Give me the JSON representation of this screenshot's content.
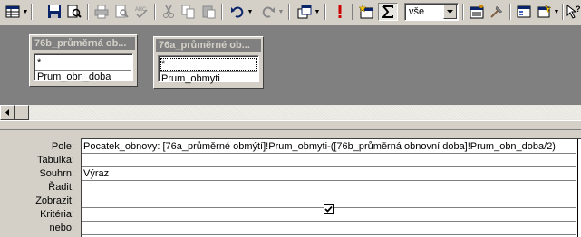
{
  "toolbar": {
    "items": [
      {
        "name": "view-icon"
      },
      {
        "name": "save-icon"
      },
      {
        "name": "search-icon"
      },
      {
        "name": "print-icon"
      },
      {
        "name": "print-preview-icon"
      },
      {
        "name": "spelling-icon"
      },
      {
        "name": "cut-icon"
      },
      {
        "name": "copy-icon"
      },
      {
        "name": "paste-icon"
      },
      {
        "name": "undo-icon"
      },
      {
        "name": "redo-icon"
      },
      {
        "name": "query-type-icon"
      },
      {
        "name": "run-icon"
      },
      {
        "name": "show-table-icon"
      },
      {
        "name": "totals-icon"
      },
      {
        "name": "properties-icon"
      },
      {
        "name": "build-icon"
      },
      {
        "name": "database-window-icon"
      },
      {
        "name": "new-object-icon"
      },
      {
        "name": "help-icon"
      }
    ],
    "top_values": {
      "value": "vše"
    }
  },
  "tables": [
    {
      "title": "76b_průměrná ob...",
      "fields": [
        "*",
        "Prum_obn_doba"
      ]
    },
    {
      "title": "76a_průměrné ob...",
      "fields": [
        "*",
        "Prum_obmyti"
      ]
    }
  ],
  "grid": {
    "row_labels": {
      "field": "Pole:",
      "table": "Tabulka:",
      "total": "Souhrn:",
      "sort": "Řadit:",
      "show": "Zobrazit:",
      "criteria": "Kritéria:",
      "or": "nebo:"
    },
    "column1": {
      "field": "Pocatek_obnovy: [76a_průměrné obmýtí]!Prum_obmyti-([76b_průměrná obnovní doba]!Prum_obn_doba/2)",
      "table": "",
      "total": "Výraz",
      "sort": "",
      "show_checked": true,
      "criteria": "",
      "or": ""
    }
  },
  "colors": {
    "face": "#d4d0c8",
    "workspace": "#808080",
    "title_inactive": "#808080",
    "accent_red": "#cc0000"
  }
}
